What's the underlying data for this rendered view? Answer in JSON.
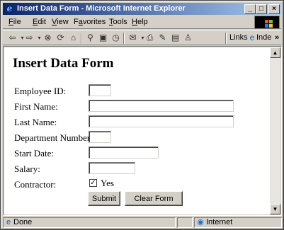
{
  "window": {
    "title": "Insert Data Form - Microsoft Internet Explorer",
    "min_label": "_",
    "max_label": "□",
    "close_label": "×"
  },
  "menu": {
    "items": [
      {
        "key": "F",
        "rest": "ile"
      },
      {
        "key": "E",
        "rest": "dit"
      },
      {
        "key": "V",
        "rest": "iew"
      },
      {
        "key": "F",
        "rest": "avorites",
        "prefix": ""
      },
      {
        "key": "T",
        "rest": "ools"
      },
      {
        "key": "H",
        "rest": "elp"
      }
    ]
  },
  "toolbar": {
    "links_label": "Links",
    "inde_label": "Inde",
    "more_label": "»",
    "icons": [
      "back-icon",
      "forward-icon",
      "stop-icon",
      "refresh-icon",
      "home-icon",
      "search-icon",
      "favorites-icon",
      "history-icon",
      "mail-icon",
      "print-icon",
      "edit-icon",
      "discuss-icon",
      "messenger-icon"
    ]
  },
  "form": {
    "heading": "Insert Data Form",
    "labels": {
      "employee_id": "Employee ID:",
      "first_name": "First Name:",
      "last_name": "Last Name:",
      "department_number": "Department Number:",
      "start_date": "Start Date:",
      "salary": "Salary:",
      "contractor": "Contractor:"
    },
    "values": {
      "employee_id": "",
      "first_name": "",
      "last_name": "",
      "department_number": "",
      "start_date": "",
      "salary": ""
    },
    "contractor_checked": true,
    "contractor_option": "Yes",
    "submit_label": "Submit",
    "clear_label": "Clear Form"
  },
  "status": {
    "text": "Done",
    "zone": "Internet"
  },
  "colors": {
    "titlebar_start": "#0a246a",
    "titlebar_end": "#a6caf0",
    "chrome": "#d4d0c8"
  }
}
